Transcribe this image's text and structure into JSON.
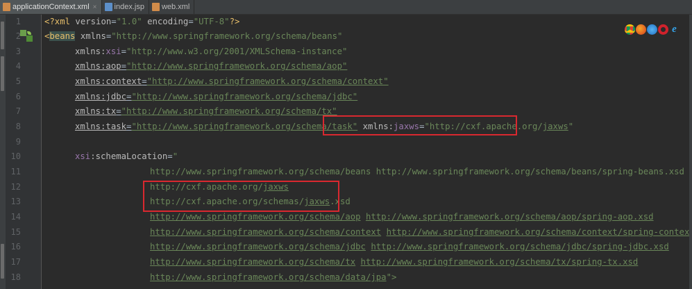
{
  "tabs": [
    {
      "label": "applicationContext.xml",
      "active": true,
      "icon": "xml-file-icon"
    },
    {
      "label": "index.jsp",
      "active": false,
      "icon": "jsp-file-icon"
    },
    {
      "label": "web.xml",
      "active": false,
      "icon": "xml-file-icon"
    }
  ],
  "close_glyph": "×",
  "line_numbers": [
    "1",
    "2",
    "3",
    "4",
    "5",
    "6",
    "7",
    "8",
    "9",
    "10",
    "11",
    "12",
    "13",
    "14",
    "15",
    "16",
    "17",
    "18"
  ],
  "code": {
    "l1": {
      "a": "<?xml ",
      "b": "version",
      "c": "=",
      "d": "\"1.0\"",
      "e": " ",
      "f": "encoding",
      "g": "=",
      "h": "\"UTF-8\"",
      "i": "?>"
    },
    "l2": {
      "a": "<",
      "b": "beans",
      "c": " xmlns",
      "d": "=",
      "e": "\"http://www.springframework.org/schema/beans\""
    },
    "l3": {
      "a": "xmlns:",
      "b": "xsi",
      "c": "=",
      "d": "\"http://www.w3.org/2001/XMLSchema-instance\""
    },
    "l4": {
      "a": "xmlns:aop",
      "b": "=",
      "c": "\"http://www.springframework.org/schema/aop\""
    },
    "l5": {
      "a": "xmlns:context",
      "b": "=",
      "c": "\"http://www.springframework.org/schema/context\""
    },
    "l6": {
      "a": "xmlns:jdbc",
      "b": "=",
      "c": "\"http://www.springframework.org/schema/jdbc\""
    },
    "l7": {
      "a": "xmlns:tx",
      "b": "=",
      "c": "\"http://www.springframework.org/schema/tx\""
    },
    "l8": {
      "a": "xmlns:task",
      "b": "=",
      "c": "\"http://www.springframework.org/schema/task\"",
      "d": " ",
      "e": "xmlns:",
      "f": "jaxws",
      "g": "=",
      "h": "\"http://cxf.apache.org/",
      "i": "jaxws",
      "j": "\""
    },
    "l10": {
      "a": "xsi",
      "b": ":schemaLocation",
      "c": "=",
      "d": "\""
    },
    "l11": {
      "a": "http://www.springframework.org/schema/beans http://www.springframework.org/schema/beans/spring-beans.xsd"
    },
    "l12": {
      "a": "http://cxf.apache.org/",
      "b": "jaxws"
    },
    "l13": {
      "a": "http://cxf.apache.org/schemas/",
      "b": "jaxws",
      "c": ".xsd"
    },
    "l14": {
      "a": "http://www.springframework.org/schema/aop",
      "b": " ",
      "c": "http://www.springframework.org/schema/aop/spring-aop.xsd"
    },
    "l15": {
      "a": "http://www.springframework.org/schema/context",
      "b": " ",
      "c": "http://www.springframework.org/schema/context/spring-context.xsd"
    },
    "l16": {
      "a": "http://www.springframework.org/schema/jdbc",
      "b": " ",
      "c": "http://www.springframework.org/schema/jdbc/spring-jdbc.xsd"
    },
    "l17": {
      "a": "http://www.springframework.org/schema/tx",
      "b": " ",
      "c": "http://www.springframework.org/schema/tx/spring-tx.xsd"
    },
    "l18": {
      "a": "http://www.springframework.org/schema/data/jpa",
      "b": "\">"
    }
  },
  "browser_icons": [
    "chrome-icon",
    "firefox-icon",
    "safari-icon",
    "opera-icon",
    "ie-icon"
  ],
  "colors": {
    "background": "#2b2b2b",
    "tag": "#e8bf6a",
    "string": "#6a8759",
    "namespace": "#9876aa",
    "highlight_box": "#d9282f"
  }
}
